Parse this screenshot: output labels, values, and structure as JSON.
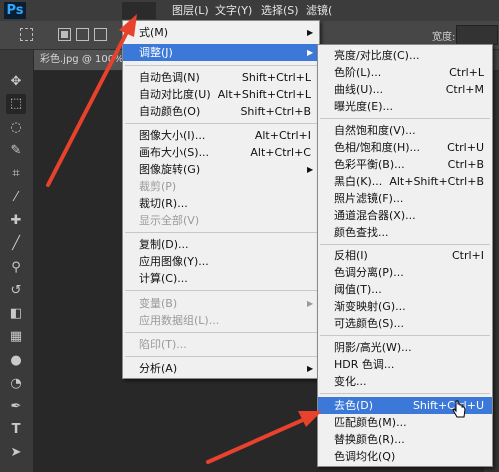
{
  "app": {
    "logo": "Ps"
  },
  "menubar": {
    "items": [
      {
        "label": "图层(L)"
      },
      {
        "label": "文字(Y)"
      },
      {
        "label": "选择(S)"
      },
      {
        "label": "滤镜("
      }
    ]
  },
  "options_bar": {
    "width_label": "宽度:"
  },
  "document": {
    "tab_title": "彩色.jpg @ 100%("
  },
  "image_menu": {
    "items": [
      {
        "label": "式(M)",
        "submenu": true
      },
      {
        "label": "调整(J)",
        "submenu": true
      },
      {
        "label": "自动色调(N)",
        "shortcut": "Shift+Ctrl+L"
      },
      {
        "label": "自动对比度(U)",
        "shortcut": "Alt+Shift+Ctrl+L"
      },
      {
        "label": "自动颜色(O)",
        "shortcut": "Shift+Ctrl+B"
      },
      {
        "label": "图像大小(I)...",
        "shortcut": "Alt+Ctrl+I"
      },
      {
        "label": "画布大小(S)...",
        "shortcut": "Alt+Ctrl+C"
      },
      {
        "label": "图像旋转(G)",
        "submenu": true
      },
      {
        "label": "裁剪(P)"
      },
      {
        "label": "裁切(R)..."
      },
      {
        "label": "显示全部(V)"
      },
      {
        "label": "复制(D)..."
      },
      {
        "label": "应用图像(Y)..."
      },
      {
        "label": "计算(C)..."
      },
      {
        "label": "变量(B)",
        "submenu": true
      },
      {
        "label": "应用数据组(L)..."
      },
      {
        "label": "陷印(T)..."
      },
      {
        "label": "分析(A)",
        "submenu": true
      }
    ]
  },
  "adjust_submenu": {
    "items": [
      {
        "label": "亮度/对比度(C)..."
      },
      {
        "label": "色阶(L)...",
        "shortcut": "Ctrl+L"
      },
      {
        "label": "曲线(U)...",
        "shortcut": "Ctrl+M"
      },
      {
        "label": "曝光度(E)..."
      },
      {
        "label": "自然饱和度(V)..."
      },
      {
        "label": "色相/饱和度(H)...",
        "shortcut": "Ctrl+U"
      },
      {
        "label": "色彩平衡(B)...",
        "shortcut": "Ctrl+B"
      },
      {
        "label": "黑白(K)...",
        "shortcut": "Alt+Shift+Ctrl+B"
      },
      {
        "label": "照片滤镜(F)..."
      },
      {
        "label": "通道混合器(X)..."
      },
      {
        "label": "颜色查找..."
      },
      {
        "label": "反相(I)",
        "shortcut": "Ctrl+I"
      },
      {
        "label": "色调分离(P)..."
      },
      {
        "label": "阈值(T)..."
      },
      {
        "label": "渐变映射(G)..."
      },
      {
        "label": "可选颜色(S)..."
      },
      {
        "label": "阴影/高光(W)..."
      },
      {
        "label": "HDR 色调..."
      },
      {
        "label": "变化..."
      },
      {
        "label": "去色(D)",
        "shortcut": "Shift+Ctrl+U"
      },
      {
        "label": "匹配颜色(M)..."
      },
      {
        "label": "替换颜色(R)..."
      },
      {
        "label": "色调均化(Q)"
      }
    ]
  },
  "colors": {
    "highlight": "#3b78d8",
    "annotation_arrow": "#e8412c",
    "menu_background": "#f0f0f0",
    "app_dark": "#3c3c3c"
  }
}
